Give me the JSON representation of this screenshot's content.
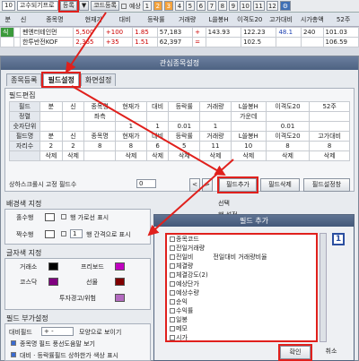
{
  "toolbar": {
    "num": "10",
    "symbol": "고수되기프로",
    "register_btn": "등록",
    "dropdown": "▼",
    "code_register": "코드등록",
    "anticipate_label": "예상",
    "tabs": [
      "1",
      "2",
      "3",
      "4",
      "5",
      "6",
      "7",
      "8",
      "9",
      "10",
      "11",
      "12"
    ]
  },
  "bg_header": [
    "분",
    "신",
    "종목명",
    "현재가",
    "대비",
    "등락률",
    "거래량",
    "L쓸봉H",
    "이격도20",
    "고가대비",
    "시가총액",
    "52주"
  ],
  "bg_rows": [
    [
      "식",
      "",
      "펜엔터테인먼",
      "5,500",
      "+100",
      "1.85",
      "57,183",
      "+",
      "143.93",
      "122.23",
      "48.1",
      "240",
      "101.03"
    ],
    [
      "",
      "",
      "한투반전KOF",
      "2,365",
      "+35",
      "1.51",
      "62,397",
      "=",
      "",
      "102.5",
      "",
      "",
      "106.59"
    ]
  ],
  "dialog": {
    "title": "관심종목설정",
    "tabs": [
      "종목등록",
      "필드설정",
      "화면설정"
    ],
    "field_edit_title": "필드편집",
    "grid": {
      "rows": [
        [
          "필드",
          "분",
          "신",
          "종목명",
          "현재가",
          "대비",
          "등락률",
          "거래량",
          "L쓸봉H",
          "이격도20",
          "52주"
        ],
        [
          "정렬",
          "",
          "",
          "좌측",
          "",
          "",
          "",
          "",
          "가운데",
          "",
          ""
        ],
        [
          "숫자단위",
          "",
          "",
          "",
          "1",
          "1",
          "0.01",
          "1",
          "",
          "0.01",
          ""
        ],
        [
          "필드명",
          "분",
          "신",
          "종목명",
          "현재가",
          "대비",
          "등락률",
          "거래량",
          "L쓸봉H",
          "이격도20",
          "고가대비"
        ],
        [
          "자리수",
          "2",
          "2",
          "8",
          "8",
          "6",
          "5",
          "11",
          "10",
          "8",
          "8"
        ],
        [
          "",
          "삭제",
          "삭제",
          "",
          "삭제",
          "삭제",
          "삭제",
          "삭제",
          "삭제",
          "삭제",
          "삭제"
        ]
      ]
    },
    "scroll_fixed_label": "상하스크롤시 고정 필드수",
    "scroll_fixed_value": "0",
    "add_field_btn": "필드추가",
    "delete_field_btn": "필드삭제",
    "field_init_btn": "필드설정창",
    "bg_section": "배경색 지정",
    "odd_row": "홀수행",
    "even_row": "짝수행",
    "row_horizontal": "행 가로선 표시",
    "row_interval": "행 간격으로 표시",
    "interval_value": "1",
    "select_label": "선택",
    "row_setting": "행 설정",
    "font_section": "글자색 지정",
    "rise": "거래소",
    "front": "프리보드",
    "kosdaq": "코스닥",
    "elw": "선물",
    "invest_warn": "투자경고/위험",
    "field_extra_section": "필드 부가설정",
    "compare_label": "대비필드",
    "compare_value": "+ -",
    "shape_label": "모양으로 보이기",
    "chk1": "종목명 필드 풍선도움말 보기",
    "chk2": "대비 · 등락률필드 상하한가 색상 표시"
  },
  "popup": {
    "title": "필드 추가",
    "badge": "1",
    "items": [
      "종목코드",
      "전일거래량",
      "전일비",
      "체결량",
      "체결강도(2)",
      "예상단가",
      "예상수량",
      "순익",
      "수익률",
      "일봉",
      "메모",
      "시가"
    ],
    "desc": "전일대비 거래량비율",
    "confirm_btn": "확인",
    "cancel_btn": "취소"
  },
  "colors": {
    "red_highlight": "#e0201c",
    "swatch_black": "#000000",
    "swatch_magenta": "#c000c0",
    "swatch_purple": "#800080",
    "swatch_darkred": "#800000",
    "swatch_orchid": "#b36ac0"
  }
}
